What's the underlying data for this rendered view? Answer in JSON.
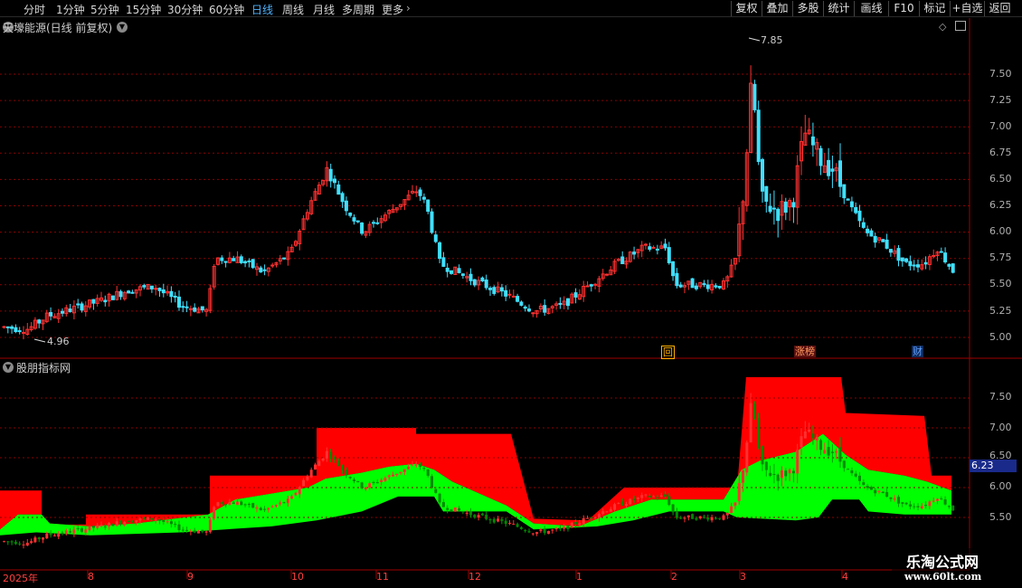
{
  "toolbar": {
    "periods": [
      "分时",
      "1分钟",
      "5分钟",
      "15分钟",
      "30分钟",
      "60分钟",
      "日线",
      "周线",
      "月线",
      "多周期",
      "更多"
    ],
    "active_period": "日线",
    "tools": [
      "复权",
      "叠加",
      "多股",
      "统计",
      "画线",
      "F10",
      "标记",
      "+自选",
      "返回"
    ]
  },
  "main_panel": {
    "title": "天壕能源(日线 前复权)",
    "high_marker": "7.85",
    "low_marker": "4.96",
    "y_ticks": [
      "7.50",
      "7.25",
      "7.00",
      "6.75",
      "6.50",
      "6.25",
      "6.00",
      "5.75",
      "5.50",
      "5.25",
      "5.00"
    ],
    "badges": [
      {
        "text": "回",
        "color": "#ffb000"
      },
      {
        "text": "涨榜",
        "color": "#ff8040"
      },
      {
        "text": "财",
        "color": "#4080ff"
      }
    ]
  },
  "indicator_panel": {
    "title": "股朋指标网",
    "y_ticks": [
      "7.50",
      "7.00",
      "6.50",
      "6.00",
      "5.50"
    ],
    "price_tag": "6.23"
  },
  "x_axis": {
    "labels": [
      "2025年",
      "8",
      "9",
      "10",
      "11",
      "12",
      "1",
      "2",
      "3",
      "4"
    ]
  },
  "watermark": {
    "title": "乐淘公式网",
    "url": "www.60lt.com"
  },
  "colors": {
    "up": "#ff3030",
    "down": "#40e0ff",
    "band_red": "#ff0000",
    "band_green": "#00ff00",
    "grid": "#8a0000",
    "active": "#4fb3ff"
  },
  "chart_data": {
    "type": "candlestick",
    "price_range": [
      4.96,
      7.85
    ],
    "high": 7.85,
    "low": 4.96,
    "last": 6.23
  }
}
